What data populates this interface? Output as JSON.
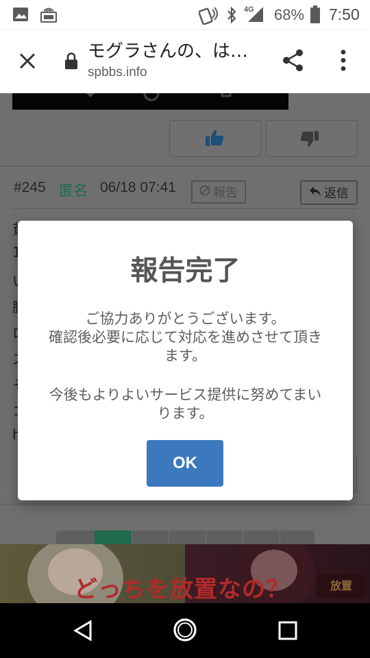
{
  "status_bar": {
    "network": "4G",
    "battery": "68%",
    "time": "7:50"
  },
  "browser": {
    "page_title": "モグラさんの、は…",
    "url": "spbbs.info"
  },
  "post": {
    "number": "#245",
    "author": "匿名",
    "datetime": "06/18 07:41",
    "report_label": "報告",
    "reply_label": "返信",
    "body_fragments": [
      "貧",
      "1",
      "い",
      "勝",
      "ロ",
      "ス",
      "そ",
      "コ",
      "h"
    ]
  },
  "dialog": {
    "title": "報告完了",
    "message_line1": "ご協力ありがとうございます。",
    "message_line2": "確認後必要に応じて対応を進めさせて頂き",
    "message_line3": "ます。",
    "message_line4": "今後もよりよいサービス提供に努めてまい",
    "message_line5": "ります。",
    "ok_label": "OK"
  },
  "ad": {
    "text": "どっちを放置なの？"
  },
  "colors": {
    "accent_green": "#2a8a64",
    "ok_button": "#3b78bd",
    "author_green": "#1f6b4c"
  },
  "icons": [
    "image-icon",
    "cast-icon",
    "nfc-icon",
    "bluetooth-icon",
    "signal-icon",
    "battery-icon",
    "close-icon",
    "lock-icon",
    "share-icon",
    "more-vert-icon",
    "thumbs-up-icon",
    "thumbs-down-icon",
    "block-icon",
    "reply-icon",
    "back-icon",
    "home-icon",
    "recents-icon"
  ]
}
